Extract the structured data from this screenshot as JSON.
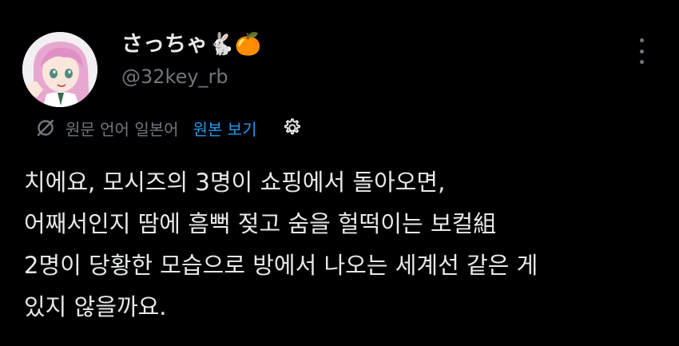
{
  "author": {
    "display_name": "さっちゃ🐇🍊",
    "handle": "@32key_rb"
  },
  "translation_bar": {
    "icon": "translate-off-icon",
    "note": "원문 언어 일본어",
    "show_original_label": "원본 보기",
    "settings_icon": "gear-icon"
  },
  "more_icon": "more-vertical-icon",
  "tweet": {
    "lines": [
      "치에요, 모시즈의 3명이 쇼핑에서 돌아오면,",
      "어째서인지 땀에 흠뻑 젖고 숨을 헐떡이는 보컬組",
      "2명이 당황한 모습으로 방에서 나오는 세계선 같은 게",
      "있지 않을까요."
    ]
  },
  "colors": {
    "background": "#000000",
    "primary_text": "#e7e9ea",
    "secondary_text": "#71767b",
    "link": "#1d9bf0"
  }
}
